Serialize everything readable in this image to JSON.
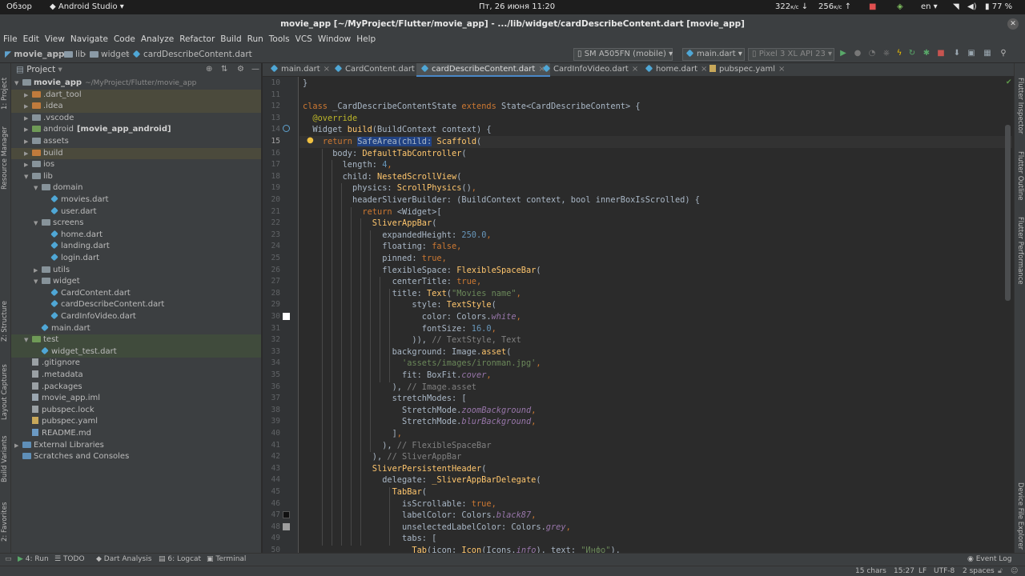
{
  "topbar": {
    "overview": "Обзор",
    "app": "Android Studio",
    "datetime": "Пт, 26 июня  11:20",
    "net_down": "322",
    "net_down_unit": "к/с",
    "net_up": "256",
    "net_up_unit": "к/с",
    "lang": "en",
    "battery": "77 %"
  },
  "window": {
    "title": "movie_app [~/MyProject/Flutter/movie_app] - .../lib/widget/cardDescribeContent.dart [movie_app]",
    "close_glyph": "✕"
  },
  "menu": [
    "File",
    "Edit",
    "View",
    "Navigate",
    "Code",
    "Analyze",
    "Refactor",
    "Build",
    "Run",
    "Tools",
    "VCS",
    "Window",
    "Help"
  ],
  "breadcrumb": {
    "project": "movie_app",
    "lib": "lib",
    "widget": "widget",
    "file": "cardDescribeContent.dart"
  },
  "toolbar": {
    "device": "SM A505FN (mobile)",
    "target": "main.dart",
    "avd": "Pixel 3 XL API 23"
  },
  "project_panel": {
    "header": "Project",
    "tree": [
      {
        "label": "movie_app",
        "extra": "~/MyProject/Flutter/movie_app",
        "kind": "root",
        "depth": 0,
        "arrow": "▼"
      },
      {
        "label": ".dart_tool",
        "kind": "folder-orange",
        "depth": 1,
        "arrow": "▶",
        "hl": "excl"
      },
      {
        "label": ".idea",
        "kind": "folder-orange",
        "depth": 1,
        "arrow": "▶",
        "hl": "excl"
      },
      {
        "label": ".vscode",
        "kind": "folder",
        "depth": 1,
        "arrow": "▶"
      },
      {
        "label": "android",
        "extra": "[movie_app_android]",
        "kind": "folder-green",
        "depth": 1,
        "arrow": "▶"
      },
      {
        "label": "assets",
        "kind": "folder",
        "depth": 1,
        "arrow": "▶"
      },
      {
        "label": "build",
        "kind": "folder-orange",
        "depth": 1,
        "arrow": "▶",
        "hl": "excl"
      },
      {
        "label": "ios",
        "kind": "folder",
        "depth": 1,
        "arrow": "▶"
      },
      {
        "label": "lib",
        "kind": "folder",
        "depth": 1,
        "arrow": "▼"
      },
      {
        "label": "domain",
        "kind": "folder",
        "depth": 2,
        "arrow": "▼"
      },
      {
        "label": "movies.dart",
        "kind": "dart",
        "depth": 3
      },
      {
        "label": "user.dart",
        "kind": "dart",
        "depth": 3
      },
      {
        "label": "screens",
        "kind": "folder",
        "depth": 2,
        "arrow": "▼"
      },
      {
        "label": "home.dart",
        "kind": "dart",
        "depth": 3
      },
      {
        "label": "landing.dart",
        "kind": "dart",
        "depth": 3
      },
      {
        "label": "login.dart",
        "kind": "dart",
        "depth": 3
      },
      {
        "label": "utils",
        "kind": "folder",
        "depth": 2,
        "arrow": "▶"
      },
      {
        "label": "widget",
        "kind": "folder",
        "depth": 2,
        "arrow": "▼"
      },
      {
        "label": "CardContent.dart",
        "kind": "dart",
        "depth": 3
      },
      {
        "label": "cardDescribeContent.dart",
        "kind": "dart",
        "depth": 3
      },
      {
        "label": "CardInfoVideo.dart",
        "kind": "dart",
        "depth": 3
      },
      {
        "label": "main.dart",
        "kind": "dart",
        "depth": 2
      },
      {
        "label": "test",
        "kind": "folder-green",
        "depth": 1,
        "arrow": "▼",
        "hl": "test"
      },
      {
        "label": "widget_test.dart",
        "kind": "dart",
        "depth": 2,
        "hl": "test"
      },
      {
        "label": ".gitignore",
        "kind": "file",
        "depth": 1
      },
      {
        "label": ".metadata",
        "kind": "file",
        "depth": 1
      },
      {
        "label": ".packages",
        "kind": "file",
        "depth": 1
      },
      {
        "label": "movie_app.iml",
        "kind": "iml",
        "depth": 1
      },
      {
        "label": "pubspec.lock",
        "kind": "file",
        "depth": 1
      },
      {
        "label": "pubspec.yaml",
        "kind": "yaml",
        "depth": 1
      },
      {
        "label": "README.md",
        "kind": "md",
        "depth": 1
      },
      {
        "label": "External Libraries",
        "kind": "lib",
        "depth": 0,
        "arrow": "▶"
      },
      {
        "label": "Scratches and Consoles",
        "kind": "scratch",
        "depth": 0
      }
    ]
  },
  "tabs": [
    {
      "label": "main.dart",
      "active": false
    },
    {
      "label": "CardContent.dart",
      "active": false
    },
    {
      "label": "cardDescribeContent.dart",
      "active": true
    },
    {
      "label": "CardInfoVideo.dart",
      "active": false
    },
    {
      "label": "home.dart",
      "active": false
    },
    {
      "label": "pubspec.yaml",
      "active": false
    }
  ],
  "editor": {
    "current_line": 15,
    "lines": [
      {
        "n": 10,
        "t": [
          [
            "nm",
            "}"
          ]
        ]
      },
      {
        "n": 11,
        "t": []
      },
      {
        "n": 12,
        "t": [
          [
            "kw",
            "class "
          ],
          [
            "nm",
            "_CardDescribeContentState "
          ],
          [
            "kw",
            "extends "
          ],
          [
            "nm",
            "State<CardDescribeContent> {"
          ]
        ]
      },
      {
        "n": 13,
        "t": [
          [
            "nm",
            "  "
          ],
          [
            "an",
            "@override"
          ]
        ]
      },
      {
        "n": 14,
        "t": [
          [
            "nm",
            "  Widget "
          ],
          [
            "fn",
            "build"
          ],
          [
            "nm",
            "(BuildContext context) {"
          ]
        ]
      },
      {
        "n": 15,
        "t": [
          [
            "nm",
            "    "
          ],
          [
            "kw",
            "return "
          ],
          [
            "sel",
            "SafeArea(child:"
          ],
          [
            "nm",
            " "
          ],
          [
            "fn",
            "Scaffold"
          ],
          [
            "nm",
            "("
          ]
        ]
      },
      {
        "n": 16,
        "t": [
          [
            "nm",
            "      body: "
          ],
          [
            "fn",
            "DefaultTabController"
          ],
          [
            "nm",
            "("
          ]
        ]
      },
      {
        "n": 17,
        "t": [
          [
            "nm",
            "        length: "
          ],
          [
            "nu",
            "4"
          ],
          [
            "kw",
            ","
          ]
        ]
      },
      {
        "n": 18,
        "t": [
          [
            "nm",
            "        child: "
          ],
          [
            "fn",
            "NestedScrollView"
          ],
          [
            "nm",
            "("
          ]
        ]
      },
      {
        "n": 19,
        "t": [
          [
            "nm",
            "          physics: "
          ],
          [
            "fn",
            "ScrollPhysics"
          ],
          [
            "nm",
            "()"
          ],
          [
            "kw",
            ","
          ]
        ]
      },
      {
        "n": 20,
        "t": [
          [
            "nm",
            "          headerSliverBuilder: (BuildContext context, bool innerBoxIsScrolled) {"
          ]
        ]
      },
      {
        "n": 21,
        "t": [
          [
            "nm",
            "            "
          ],
          [
            "kw",
            "return "
          ],
          [
            "nm",
            "<Widget>["
          ]
        ]
      },
      {
        "n": 22,
        "t": [
          [
            "nm",
            "              "
          ],
          [
            "fn",
            "SliverAppBar"
          ],
          [
            "nm",
            "("
          ]
        ]
      },
      {
        "n": 23,
        "t": [
          [
            "nm",
            "                expandedHeight: "
          ],
          [
            "nu",
            "250.0"
          ],
          [
            "kw",
            ","
          ]
        ]
      },
      {
        "n": 24,
        "t": [
          [
            "nm",
            "                floating: "
          ],
          [
            "kw",
            "false,"
          ]
        ]
      },
      {
        "n": 25,
        "t": [
          [
            "nm",
            "                pinned: "
          ],
          [
            "kw",
            "true,"
          ]
        ]
      },
      {
        "n": 26,
        "t": [
          [
            "nm",
            "                flexibleSpace: "
          ],
          [
            "fn",
            "FlexibleSpaceBar"
          ],
          [
            "nm",
            "("
          ]
        ]
      },
      {
        "n": 27,
        "t": [
          [
            "nm",
            "                  centerTitle: "
          ],
          [
            "kw",
            "true,"
          ]
        ]
      },
      {
        "n": 28,
        "t": [
          [
            "nm",
            "                  title: "
          ],
          [
            "fn",
            "Text"
          ],
          [
            "nm",
            "("
          ],
          [
            "st",
            "\"Movies name\""
          ],
          [
            "kw",
            ","
          ]
        ]
      },
      {
        "n": 29,
        "t": [
          [
            "nm",
            "                      style: "
          ],
          [
            "fn",
            "TextStyle"
          ],
          [
            "nm",
            "("
          ]
        ]
      },
      {
        "n": 30,
        "t": [
          [
            "nm",
            "                        color: Colors."
          ],
          [
            "it",
            "white"
          ],
          [
            "kw",
            ","
          ]
        ]
      },
      {
        "n": 31,
        "t": [
          [
            "nm",
            "                        fontSize: "
          ],
          [
            "nu",
            "16.0"
          ],
          [
            "kw",
            ","
          ]
        ]
      },
      {
        "n": 32,
        "t": [
          [
            "nm",
            "                      )), "
          ],
          [
            "cm",
            "// TextStyle, Text"
          ]
        ]
      },
      {
        "n": 33,
        "t": [
          [
            "nm",
            "                  background: Image."
          ],
          [
            "fn",
            "asset"
          ],
          [
            "nm",
            "("
          ]
        ]
      },
      {
        "n": 34,
        "t": [
          [
            "nm",
            "                    "
          ],
          [
            "st",
            "'assets/images/ironman.jpg'"
          ],
          [
            "kw",
            ","
          ]
        ]
      },
      {
        "n": 35,
        "t": [
          [
            "nm",
            "                    fit: BoxFit."
          ],
          [
            "it",
            "cover"
          ],
          [
            "kw",
            ","
          ]
        ]
      },
      {
        "n": 36,
        "t": [
          [
            "nm",
            "                  ), "
          ],
          [
            "cm",
            "// Image.asset"
          ]
        ]
      },
      {
        "n": 37,
        "t": [
          [
            "nm",
            "                  stretchModes: ["
          ]
        ]
      },
      {
        "n": 38,
        "t": [
          [
            "nm",
            "                    StretchMode."
          ],
          [
            "it",
            "zoomBackground"
          ],
          [
            "kw",
            ","
          ]
        ]
      },
      {
        "n": 39,
        "t": [
          [
            "nm",
            "                    StretchMode."
          ],
          [
            "it",
            "blurBackground"
          ],
          [
            "kw",
            ","
          ]
        ]
      },
      {
        "n": 40,
        "t": [
          [
            "nm",
            "                  ]"
          ],
          [
            "kw",
            ","
          ]
        ]
      },
      {
        "n": 41,
        "t": [
          [
            "nm",
            "                ), "
          ],
          [
            "cm",
            "// FlexibleSpaceBar"
          ]
        ]
      },
      {
        "n": 42,
        "t": [
          [
            "nm",
            "              ), "
          ],
          [
            "cm",
            "// SliverAppBar"
          ]
        ]
      },
      {
        "n": 43,
        "t": [
          [
            "nm",
            "              "
          ],
          [
            "fn",
            "SliverPersistentHeader"
          ],
          [
            "nm",
            "("
          ]
        ]
      },
      {
        "n": 44,
        "t": [
          [
            "nm",
            "                delegate: "
          ],
          [
            "fn",
            "_SliverAppBarDelegate"
          ],
          [
            "nm",
            "("
          ]
        ]
      },
      {
        "n": 45,
        "t": [
          [
            "nm",
            "                  "
          ],
          [
            "fn",
            "TabBar"
          ],
          [
            "nm",
            "("
          ]
        ]
      },
      {
        "n": 46,
        "t": [
          [
            "nm",
            "                    isScrollable: "
          ],
          [
            "kw",
            "true,"
          ]
        ]
      },
      {
        "n": 47,
        "t": [
          [
            "nm",
            "                    labelColor: Colors."
          ],
          [
            "it",
            "black87"
          ],
          [
            "kw",
            ","
          ]
        ]
      },
      {
        "n": 48,
        "t": [
          [
            "nm",
            "                    unselectedLabelColor: Colors."
          ],
          [
            "it",
            "grey"
          ],
          [
            "kw",
            ","
          ]
        ]
      },
      {
        "n": 49,
        "t": [
          [
            "nm",
            "                    tabs: ["
          ]
        ]
      },
      {
        "n": 50,
        "t": [
          [
            "nm",
            "                      "
          ],
          [
            "fn",
            "Tab"
          ],
          [
            "nm",
            "(icon: "
          ],
          [
            "fn",
            "Icon"
          ],
          [
            "nm",
            "(Icons."
          ],
          [
            "it",
            "info"
          ],
          [
            "nm",
            "), text: "
          ],
          [
            "st",
            "\"Инфо\""
          ],
          [
            "nm",
            "),"
          ]
        ]
      }
    ]
  },
  "left_stripe": [
    "1: Project",
    "Resource Manager",
    "Z: Structure",
    "Layout Captures",
    "Build Variants",
    "2: Favorites"
  ],
  "right_stripe": [
    "Flutter Inspector",
    "Flutter Outline",
    "Flutter Performance",
    "Device File Explorer"
  ],
  "tool_windows": [
    "4: Run",
    "TODO",
    "Dart Analysis",
    "6: Logcat",
    "Terminal"
  ],
  "event_log": "Event Log",
  "status": {
    "selection": "15 chars",
    "position": "15:27",
    "line_sep": "LF",
    "encoding": "UTF-8",
    "indent": "2 spaces"
  },
  "colors": {
    "editor_bg": "#2b2b2b",
    "keyword": "#cc7832",
    "function": "#ffc66d",
    "string": "#6a8759",
    "number": "#6897bb",
    "selection": "#214283"
  }
}
